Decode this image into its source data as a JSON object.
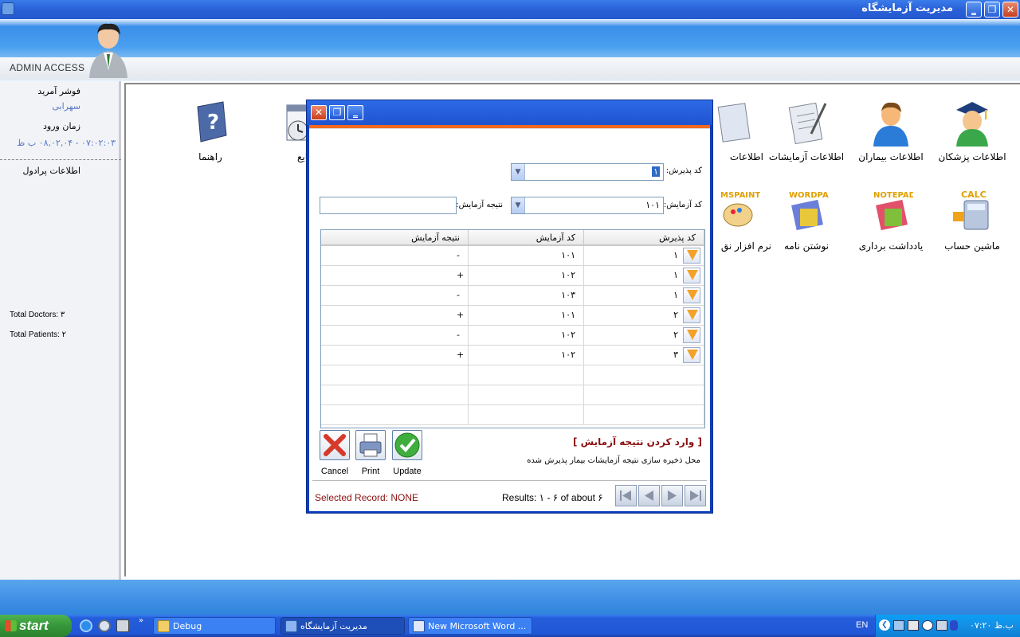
{
  "window": {
    "title": "مدیریت آزمایشگاه",
    "minimize": "‗",
    "maximize": "❐",
    "close": "✕"
  },
  "header": {
    "admin_label": "ADMIN ACCESS"
  },
  "left_panel": {
    "user_label": "فوشر آمرید",
    "user_value": "سهرابی",
    "time_label": "زمان ورود",
    "time_value": "۰۷:۰۲:۰۳ - ۰۸,۰۲,۰۴ ب ظ",
    "profile_label": "اطلاعات پرادول",
    "total_doctors": "Total Doctors: ۳",
    "total_patients": "Total Patients: ۲"
  },
  "desktop_icons": [
    {
      "label": "اطلاعات پزشکان",
      "icon": "doctor-icon"
    },
    {
      "label": "اطلاعات بیماران",
      "icon": "patient-icon"
    },
    {
      "label": "اطلاعات آزمایشات",
      "icon": "tests-icon"
    },
    {
      "label": "اطلاعات",
      "icon": "documents-icon"
    },
    {
      "label": "یات وقایع",
      "icon": "calendar-icon"
    },
    {
      "label": "راهنما",
      "icon": "help-book-icon"
    },
    {
      "label": "ماشین حساب",
      "icon": "calc-icon",
      "badge": "CALC"
    },
    {
      "label": "یادداشت برداری",
      "icon": "notepad-icon",
      "badge": "NOTEPAD"
    },
    {
      "label": "نوشتن نامه",
      "icon": "wordpad-icon",
      "badge": "WORDPAD"
    },
    {
      "label": "نرم افزار نق",
      "icon": "paint-icon",
      "badge": "MSPAINT"
    }
  ],
  "dialog": {
    "title_close": "✕",
    "title_max": "❐",
    "title_min": "‗",
    "field_admission_label": "کد پذیرش:",
    "field_admission_value": "۱",
    "field_test_label": "کد آزمایش:",
    "field_test_value": "۱۰۱",
    "field_result_label": "نتیجه آزمایش:",
    "field_result_value": "",
    "grid": {
      "headers": [
        "کد پذیرش",
        "کد آزمایش",
        "نتیجه آزمایش"
      ],
      "rows": [
        [
          "۱",
          "۱۰۱",
          "-"
        ],
        [
          "۱",
          "۱۰۲",
          "+"
        ],
        [
          "۱",
          "۱۰۳",
          "-"
        ],
        [
          "۲",
          "۱۰۱",
          "+"
        ],
        [
          "۲",
          "۱۰۲",
          "-"
        ],
        [
          "۳",
          "۱۰۲",
          "+"
        ]
      ]
    },
    "section_title": "[ وارد کردن نتیجه آزمایش ]",
    "section_desc": "محل ذخیره سازی نتیجه آزمایشات بیمار پذیرش شده",
    "cancel_label": "Cancel",
    "print_label": "Print",
    "update_label": "Update",
    "selected_record": "Selected Record: NONE",
    "results": "Results: ۱ - ۶ of about ۶"
  },
  "taskbar": {
    "start_label": "start",
    "tasks": [
      {
        "label": "Debug",
        "icon": "folder-icon"
      },
      {
        "label": "مدیریت آزمایشگاه",
        "icon": "app-icon"
      },
      {
        "label": "New Microsoft Word ...",
        "icon": "word-icon"
      }
    ],
    "lang": "EN",
    "clock": "ب.ظ ۰۷:۲۰"
  },
  "colors": {
    "accent": "#f26a1f",
    "title_blue": "#2a61d8",
    "section_red": "#8b1010"
  }
}
